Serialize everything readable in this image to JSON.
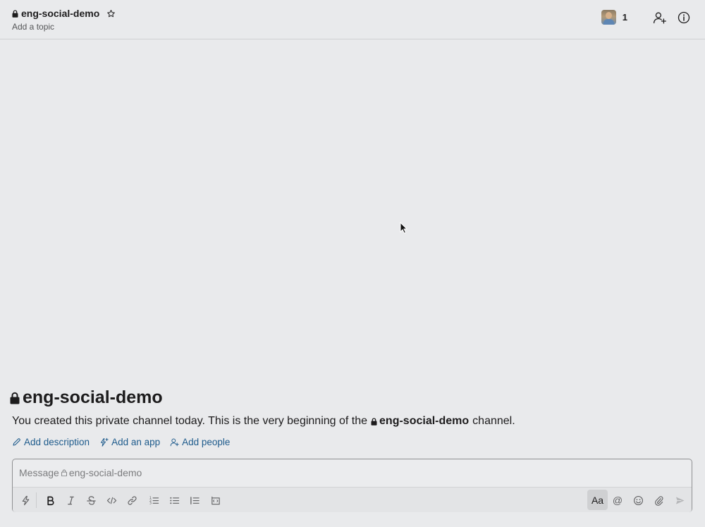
{
  "header": {
    "channel_name": "eng-social-demo",
    "topic_placeholder": "Add a topic",
    "member_count": "1"
  },
  "intro": {
    "title": "eng-social-demo",
    "text_before": "You created this private channel today. This is the very beginning of the",
    "channel_name": "eng-social-demo",
    "text_after": "channel."
  },
  "actions": [
    {
      "label": "Add description",
      "icon": "pencil-icon"
    },
    {
      "label": "Add an app",
      "icon": "lightning-plus-icon"
    },
    {
      "label": "Add people",
      "icon": "add-person-icon"
    }
  ],
  "composer": {
    "placeholder_prefix": "Message",
    "placeholder_channel": "eng-social-demo",
    "aa_label": "Aa",
    "at_label": "@"
  },
  "colors": {
    "background": "#e9eaec",
    "link": "#1e5b8c",
    "text": "#1d1c1d"
  }
}
